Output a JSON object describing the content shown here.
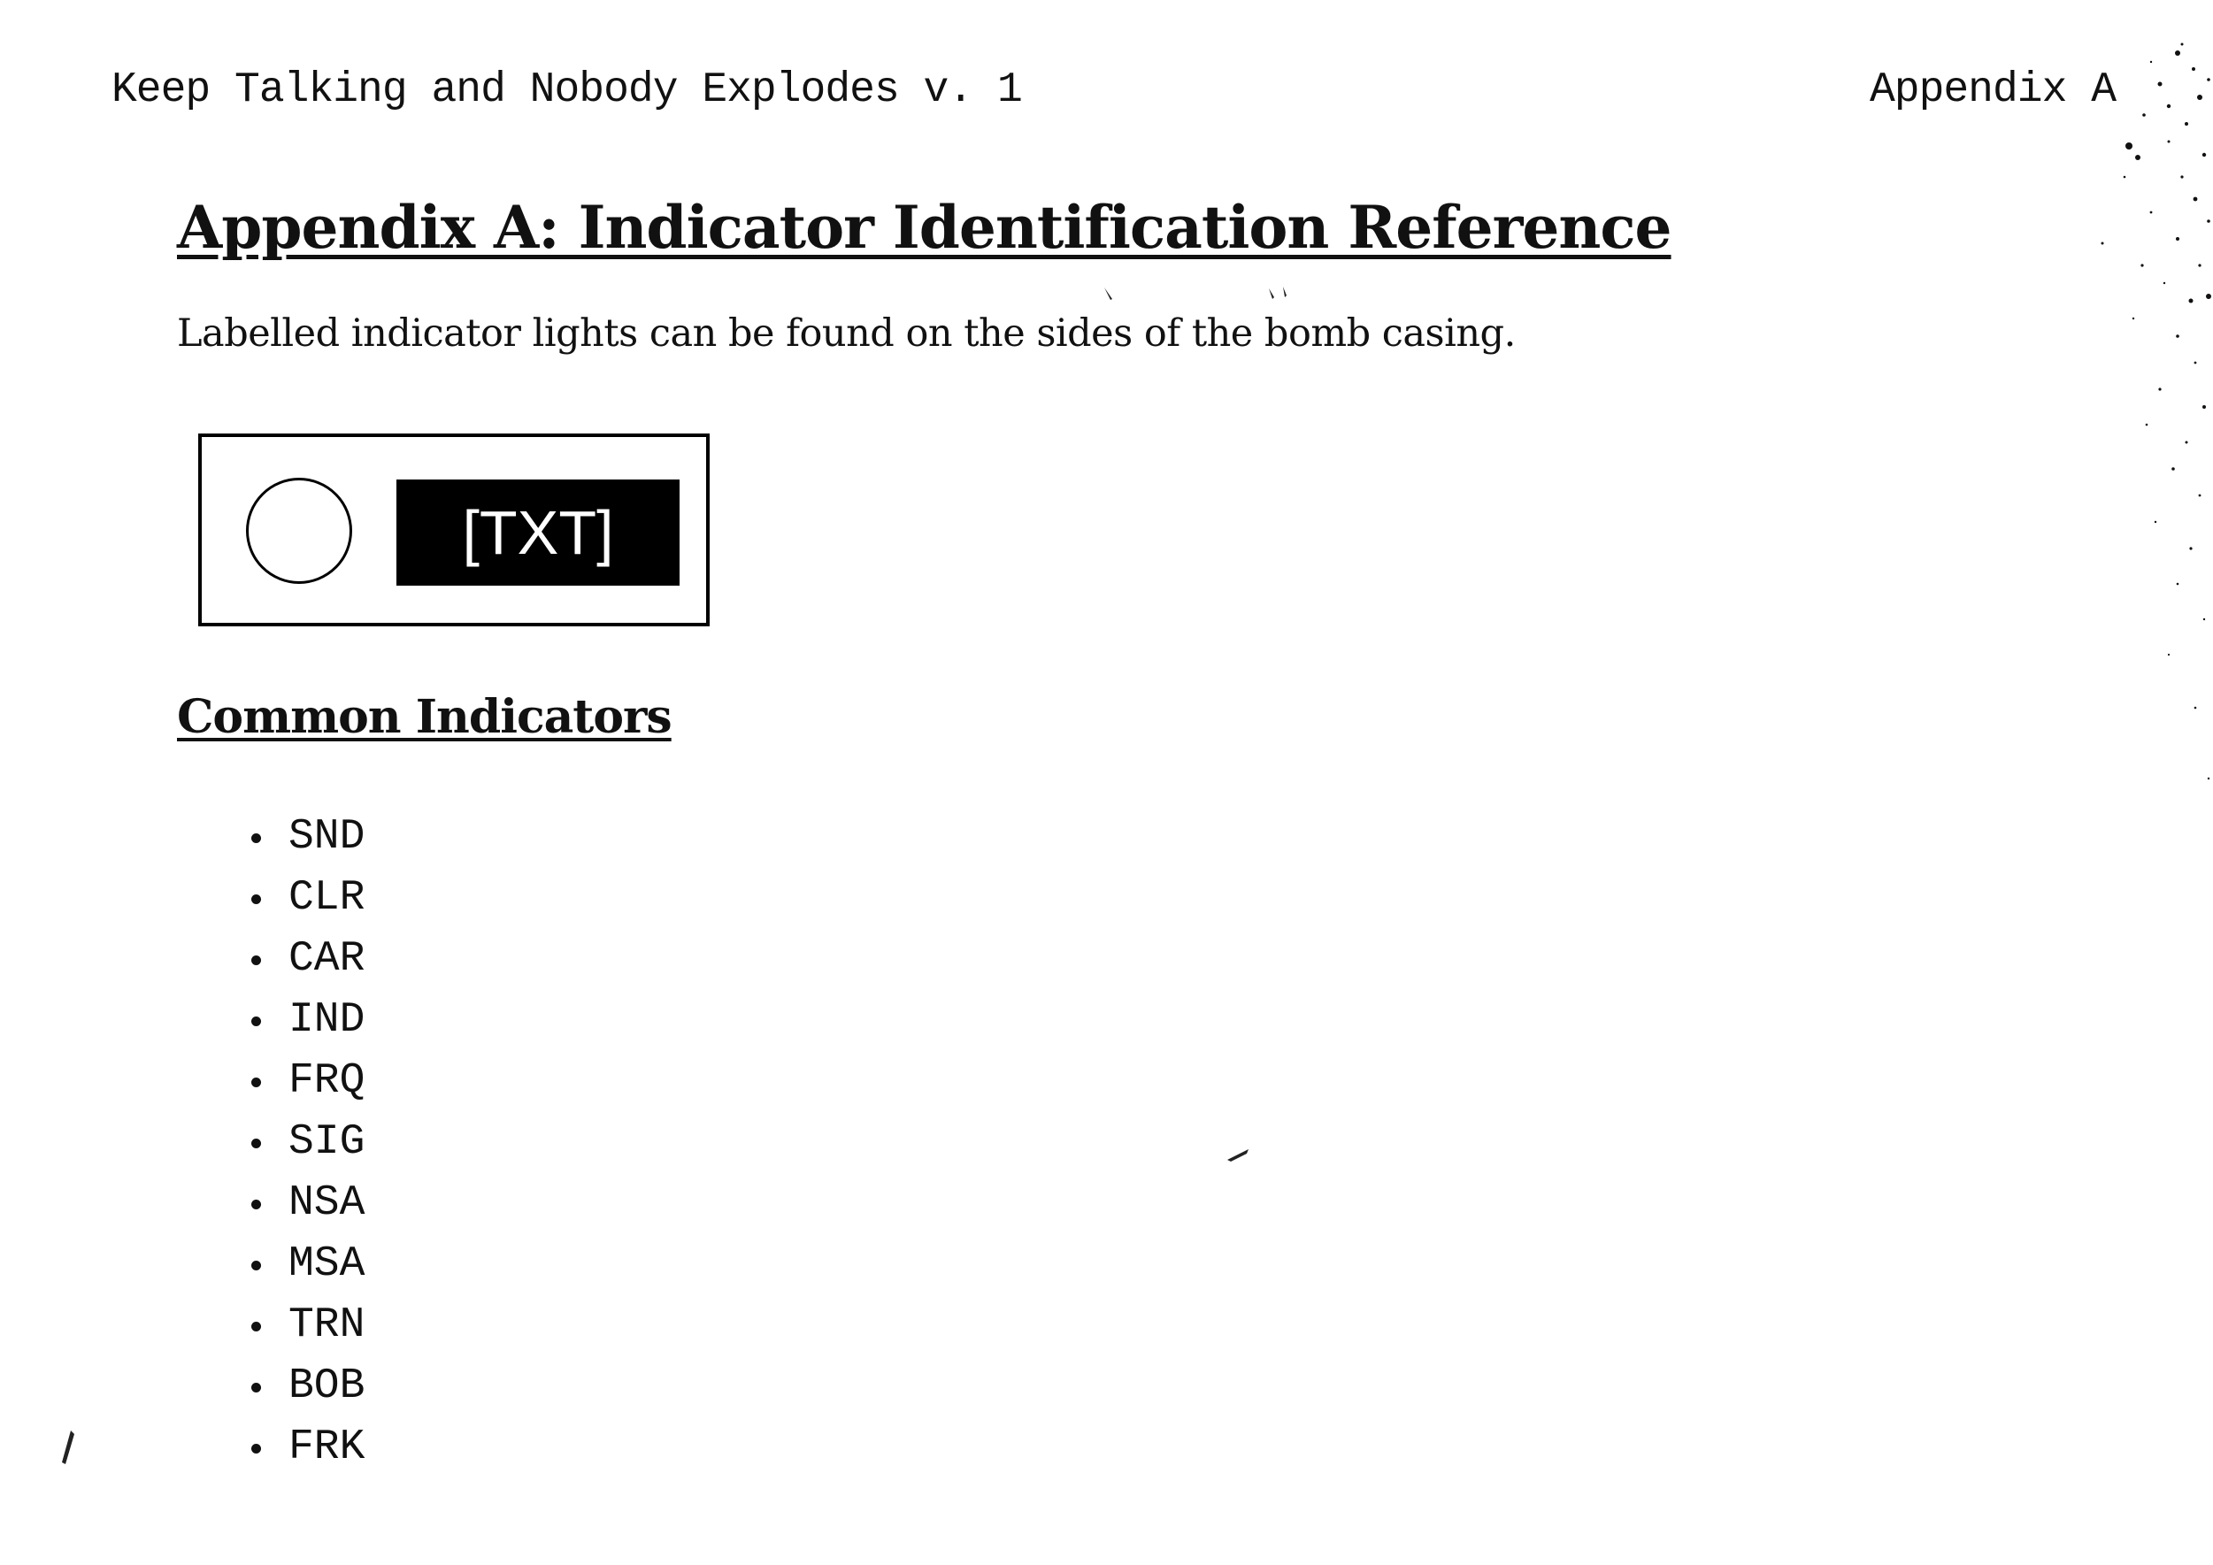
{
  "header": {
    "left_text": "Keep Talking and Nobody Explodes v. 1",
    "right_text": "Appendix A"
  },
  "title": "Appendix A: Indicator Identification Reference",
  "intro": "Labelled indicator lights can be found on the sides of the bomb casing.",
  "diagram": {
    "label": "[TXT]"
  },
  "section": {
    "heading": "Common Indicators",
    "items": [
      "SND",
      "CLR",
      "CAR",
      "IND",
      "FRQ",
      "SIG",
      "NSA",
      "MSA",
      "TRN",
      "BOB",
      "FRK"
    ]
  }
}
